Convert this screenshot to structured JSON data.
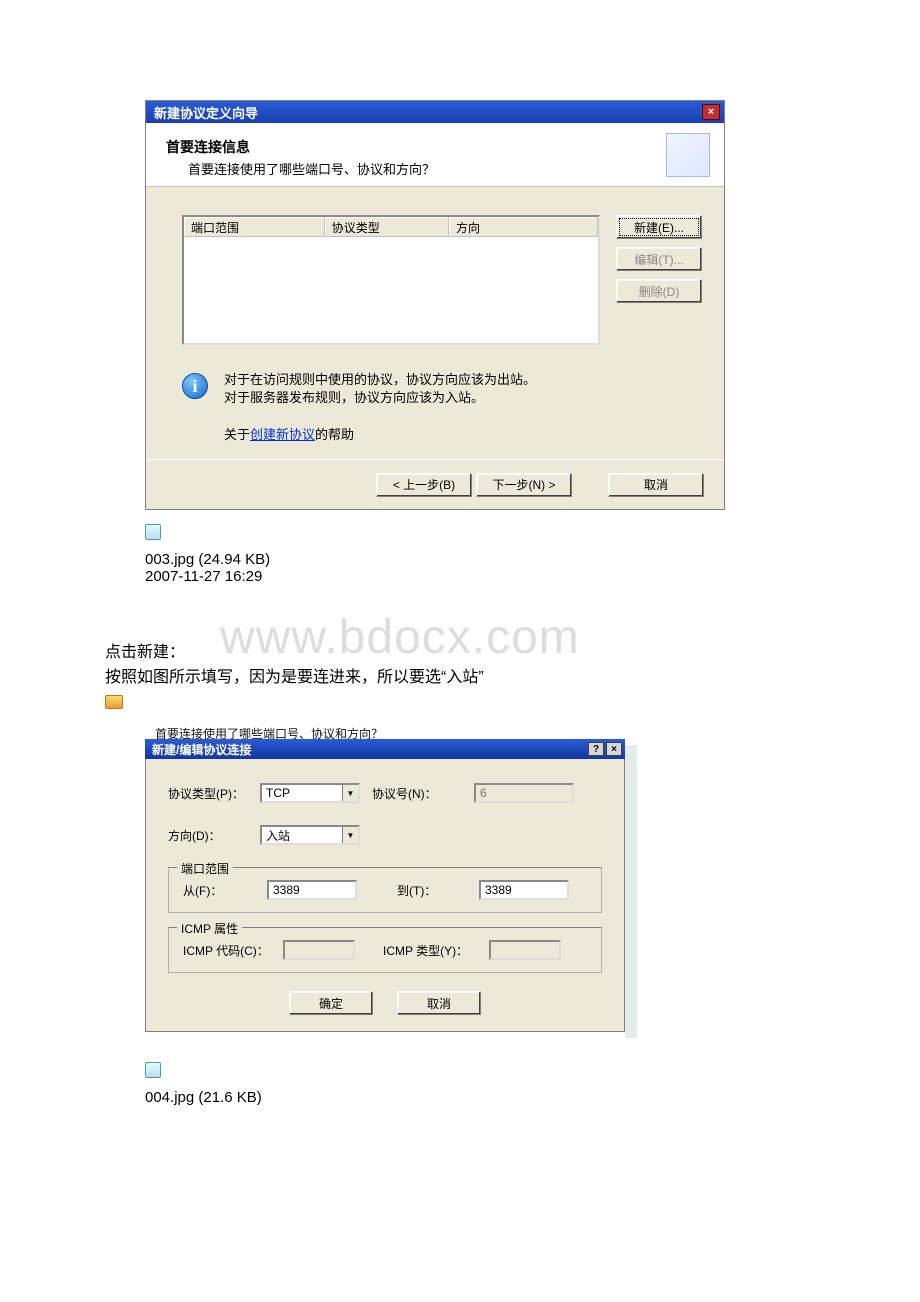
{
  "watermark": "www.bdocx.com",
  "dlg1": {
    "title": "新建协议定义向导",
    "header_h1": "首要连接信息",
    "header_h2": "首要连接使用了哪些端口号、协议和方向？",
    "cols": {
      "port": "端口范围",
      "proto": "协议类型",
      "dir": "方向"
    },
    "btn_new": "新建(E)...",
    "btn_edit": "编辑(T)...",
    "btn_del": "删除(D)",
    "info1": "对于在访问规则中使用的协议，协议方向应该为出站。",
    "info2": "对于服务器发布规则，协议方向应该为入站。",
    "help_prefix": "关于",
    "help_link": "创建新协议",
    "help_suffix": "的帮助",
    "back": "< 上一步(B)",
    "next": "下一步(N) >",
    "cancel": "取消"
  },
  "cap1_file": "003.jpg (24.94 KB)",
  "cap1_time": "2007-11-27 16:29",
  "bodytext_line1": "点击新建：",
  "bodytext_line2": "按照如图所示填写，因为是要连进来，所以要选“入站”",
  "dlg2_pre": "首要连接使用了哪些端口号、协议和方向？",
  "dlg2": {
    "title": "新建/编辑协议连接",
    "lbl_proto": "协议类型(P)：",
    "val_proto": "TCP",
    "lbl_protonum": "协议号(N)：",
    "val_protonum": "6",
    "lbl_dir": "方向(D)：",
    "val_dir": "入站",
    "grp_port": "端口范围",
    "lbl_from": "从(F)：",
    "val_from": "3389",
    "lbl_to": "到(T)：",
    "val_to": "3389",
    "grp_icmp": "ICMP 属性",
    "lbl_icmp_code": "ICMP 代码(C)：",
    "lbl_icmp_type": "ICMP 类型(Y)：",
    "ok": "确定",
    "cancel": "取消"
  },
  "cap2_file": "004.jpg (21.6 KB)"
}
